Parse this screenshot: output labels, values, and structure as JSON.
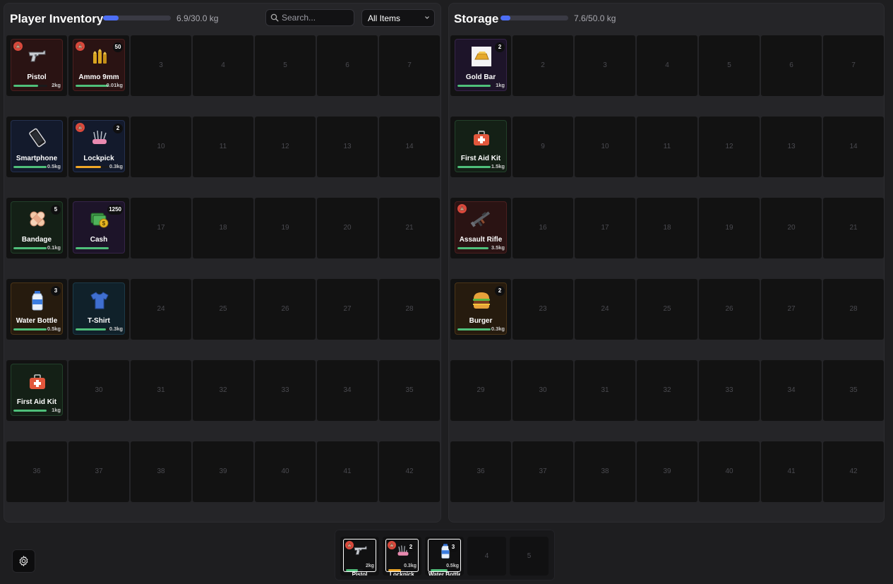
{
  "player": {
    "title": "Player Inventory",
    "weight_text": "6.9/30.0 kg",
    "weight_fraction": 0.23,
    "search_placeholder": "Search...",
    "filter_value": "All Items",
    "total_slots": 42,
    "items": [
      {
        "slot": 1,
        "label": "Pistol",
        "weight": "2kg",
        "icon": "pistol-icon",
        "rarity": "red",
        "warning": true,
        "count": "",
        "durability": 0.72,
        "durability_color": "#4fbf7a"
      },
      {
        "slot": 2,
        "label": "Ammo 9mm",
        "weight": "0.01kg",
        "icon": "ammo-icon",
        "rarity": "red",
        "warning": true,
        "count": "50",
        "durability": 0.98,
        "durability_color": "#4fbf7a"
      },
      {
        "slot": 8,
        "label": "Smartphone",
        "weight": "0.5kg",
        "icon": "smartphone-icon",
        "rarity": "blue",
        "warning": false,
        "count": "",
        "durability": 0.98,
        "durability_color": "#4fbf7a"
      },
      {
        "slot": 9,
        "label": "Lockpick",
        "weight": "0.3kg",
        "icon": "lockpick-icon",
        "rarity": "blue",
        "warning": true,
        "count": "2",
        "durability": 0.75,
        "durability_color": "#f0a727"
      },
      {
        "slot": 15,
        "label": "Bandage",
        "weight": "0.1kg",
        "icon": "bandage-icon",
        "rarity": "green",
        "warning": false,
        "count": "5",
        "durability": 0.98,
        "durability_color": "#4fbf7a"
      },
      {
        "slot": 16,
        "label": "Cash",
        "weight": "",
        "icon": "cash-icon",
        "rarity": "purple",
        "warning": false,
        "count": "1250",
        "durability": 0.98,
        "durability_color": "#4fbf7a"
      },
      {
        "slot": 22,
        "label": "Water Bottle",
        "weight": "0.5kg",
        "icon": "water-bottle-icon",
        "rarity": "orange",
        "warning": false,
        "count": "3",
        "durability": 0.98,
        "durability_color": "#4fbf7a"
      },
      {
        "slot": 23,
        "label": "T-Shirt",
        "weight": "0.3kg",
        "icon": "tshirt-icon",
        "rarity": "teal",
        "warning": false,
        "count": "",
        "durability": 0.9,
        "durability_color": "#4fbf7a"
      },
      {
        "slot": 29,
        "label": "First Aid Kit",
        "weight": "1kg",
        "icon": "first-aid-kit-icon",
        "rarity": "green",
        "warning": false,
        "count": "",
        "durability": 0.98,
        "durability_color": "#4fbf7a"
      }
    ]
  },
  "storage": {
    "title": "Storage",
    "weight_text": "7.6/50.0 kg",
    "weight_fraction": 0.15,
    "total_slots": 42,
    "items": [
      {
        "slot": 1,
        "label": "Gold Bar",
        "weight": "1kg",
        "icon": "gold-bar-icon",
        "rarity": "purple",
        "warning": false,
        "count": "2",
        "durability": 0.98,
        "durability_color": "#4fbf7a"
      },
      {
        "slot": 8,
        "label": "First Aid Kit",
        "weight": "1.5kg",
        "icon": "first-aid-kit-icon",
        "rarity": "green",
        "warning": false,
        "count": "",
        "durability": 0.98,
        "durability_color": "#4fbf7a"
      },
      {
        "slot": 15,
        "label": "Assault Rifle",
        "weight": "3.5kg",
        "icon": "assault-rifle-icon",
        "rarity": "red",
        "warning": true,
        "count": "",
        "durability": 0.92,
        "durability_color": "#4fbf7a"
      },
      {
        "slot": 22,
        "label": "Burger",
        "weight": "0.3kg",
        "icon": "burger-icon",
        "rarity": "orange",
        "warning": false,
        "count": "2",
        "durability": 0.98,
        "durability_color": "#4fbf7a"
      }
    ]
  },
  "hotbar": {
    "total_slots": 5,
    "items": [
      {
        "slot": 1,
        "label": "Pistol",
        "weight": "2kg",
        "icon": "pistol-icon",
        "rarity": "red",
        "warning": true,
        "count": "",
        "durability": 0.72,
        "durability_color": "#4fbf7a"
      },
      {
        "slot": 2,
        "label": "Lockpick",
        "weight": "0.3kg",
        "icon": "lockpick-icon",
        "rarity": "blue",
        "warning": true,
        "count": "2",
        "durability": 0.75,
        "durability_color": "#f0a727"
      },
      {
        "slot": 3,
        "label": "Water Bottle",
        "weight": "0.5kg",
        "icon": "water-bottle-icon",
        "rarity": "orange",
        "warning": false,
        "count": "3",
        "durability": 0.98,
        "durability_color": "#4fbf7a"
      }
    ]
  },
  "settings": {
    "icon": "gear-icon"
  }
}
